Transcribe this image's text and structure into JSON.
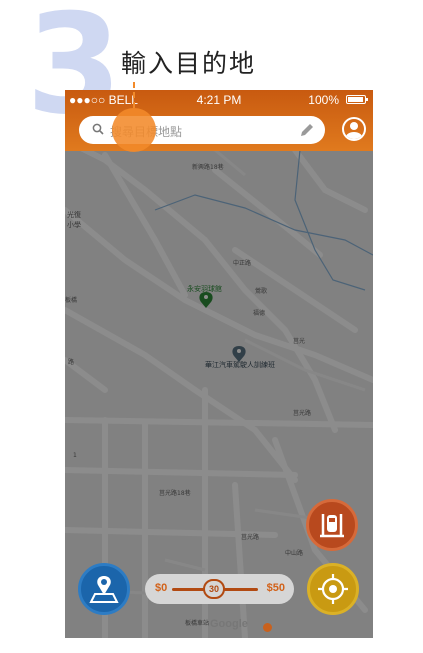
{
  "step": {
    "number": "3",
    "title": "輸入目的地"
  },
  "status_bar": {
    "carrier": "●●●○○ BELL",
    "time": "4:21 PM",
    "battery": "100%"
  },
  "search": {
    "placeholder": "搜尋目標地點"
  },
  "map": {
    "poi_1": "永安羽球館",
    "poi_2": "華江汽車駕駛人訓練班",
    "roads": [
      "新興路18巷",
      "中正路",
      "鶯歌",
      "福德",
      "莒光",
      "莒光路",
      "板橋",
      "路",
      "1",
      "莒光路18巷",
      "莒光路",
      "中山路",
      "板橋車站"
    ],
    "area_label": "光復\n小學"
  },
  "price_filter": {
    "min_label": "$0",
    "max_label": "$50",
    "current_label": "30",
    "current_value": 30,
    "min": 0,
    "max": 50
  },
  "google_label": "Google",
  "colors": {
    "header": "#e07a1e",
    "accent": "#f28a2a",
    "parking": "#b8491e",
    "map_button": "#1b65ab",
    "locate_button": "#c99a12",
    "step_number": "#cfd8f2"
  }
}
